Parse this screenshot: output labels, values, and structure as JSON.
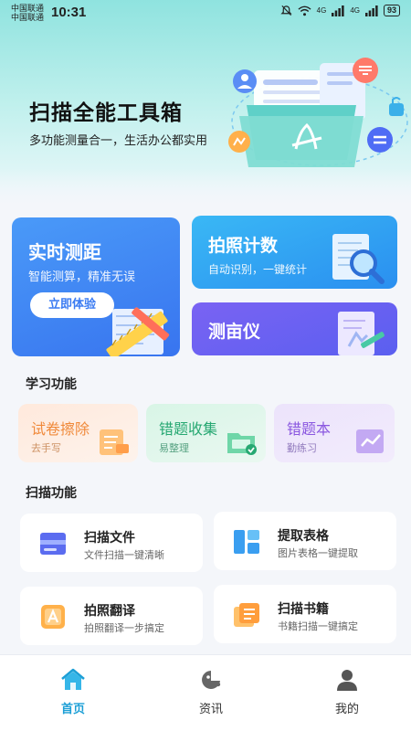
{
  "status_bar": {
    "carrier_1": "中国联通",
    "carrier_2": "中国联通",
    "time": "10:31",
    "network_1": "4G",
    "network_2": "4G",
    "battery": "93"
  },
  "hero": {
    "title": "扫描全能工具箱",
    "subtitle": "多功能测量合一，生活办公都实用"
  },
  "feature_cards": {
    "measure": {
      "title": "实时测距",
      "subtitle": "智能测算，精准无误",
      "button": "立即体验"
    },
    "count": {
      "title": "拍照计数",
      "subtitle": "自动识别，一键统计"
    },
    "acre": {
      "title": "测亩仪"
    }
  },
  "study_section": {
    "title": "学习功能",
    "items": [
      {
        "title": "试卷擦除",
        "subtitle": "去手写"
      },
      {
        "title": "错题收集",
        "subtitle": "易整理"
      },
      {
        "title": "错题本",
        "subtitle": "勤练习"
      }
    ]
  },
  "scan_section": {
    "title": "扫描功能",
    "items": [
      {
        "title": "扫描文件",
        "subtitle": "文件扫描一键清晰"
      },
      {
        "title": "提取表格",
        "subtitle": "图片表格一键提取"
      },
      {
        "title": "拍照翻译",
        "subtitle": "拍照翻译一步搞定"
      },
      {
        "title": "扫描书籍",
        "subtitle": "书籍扫描一键搞定"
      }
    ]
  },
  "tabbar": {
    "home": "首页",
    "news": "资讯",
    "mine": "我的"
  },
  "colors": {
    "primary_blue": "#3a7bf2",
    "cyan": "#2a8ff0",
    "purple": "#5a5ff0",
    "tab_active": "#1c9fd6"
  },
  "icons": {
    "hero": "document-toolbox-illustration",
    "measure": "ruler-pencil-icon",
    "count": "magnifier-document-icon",
    "acre": "field-document-icon"
  }
}
